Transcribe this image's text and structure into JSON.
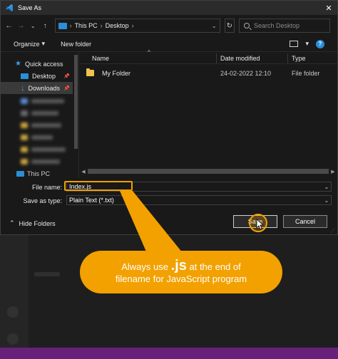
{
  "window": {
    "title": "Save As",
    "close_glyph": "✕"
  },
  "nav": {
    "back": "←",
    "forward": "→",
    "recent": "⌄",
    "up": "↑",
    "breadcrumb": [
      "This PC",
      "Desktop"
    ],
    "breadcrumb_sep": "›",
    "refresh": "↻",
    "search_placeholder": "Search Desktop"
  },
  "toolbar": {
    "organize": "Organize",
    "organize_caret": "▾",
    "new_folder": "New folder",
    "view_caret": "▾",
    "help": "?"
  },
  "sidebar": {
    "quick_access": "Quick access",
    "items": [
      {
        "label": "Desktop",
        "pinned": true
      },
      {
        "label": "Downloads",
        "pinned": true
      }
    ],
    "this_pc": "This PC"
  },
  "columns": {
    "name": "Name",
    "date": "Date modified",
    "type": "Type"
  },
  "files": [
    {
      "name": "My Folder",
      "date": "24-02-2022 12:10",
      "type": "File folder"
    }
  ],
  "form": {
    "filename_label": "File name:",
    "filename_value": "Index.js",
    "type_label": "Save as type:",
    "type_value": "Plain Text (*.txt)"
  },
  "footer": {
    "hide_folders": "Hide Folders",
    "save": "Save",
    "cancel": "Cancel"
  },
  "callout": {
    "line1_pre": "Always use",
    "line1_em": ".js",
    "line1_post": "at the end of",
    "line2": "filename for JavaScript program"
  },
  "colors": {
    "accent": "#f2a100",
    "brand_blue": "#2a8fd6",
    "strip": "#68217a"
  }
}
